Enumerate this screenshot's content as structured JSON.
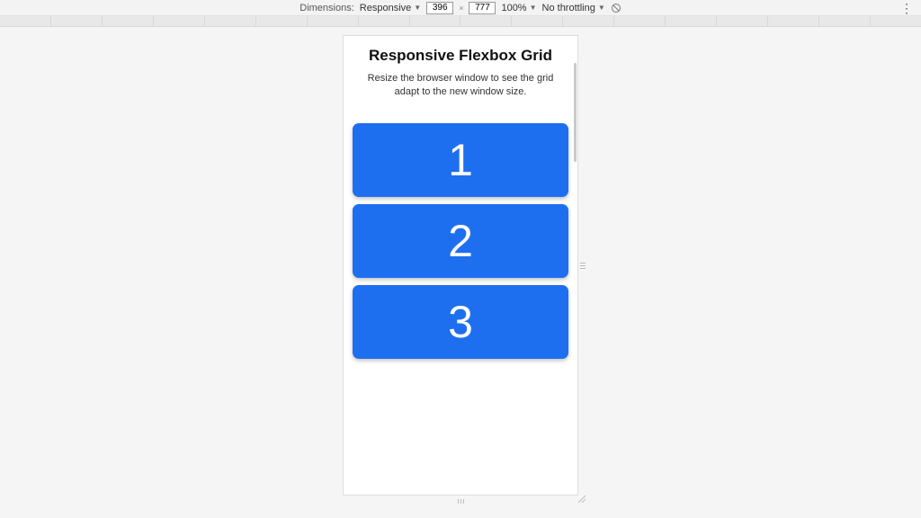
{
  "toolbar": {
    "dimensions_label": "Dimensions:",
    "device": "Responsive",
    "width": "396",
    "height": "777",
    "size_separator": "×",
    "zoom": "100%",
    "throttling": "No throttling"
  },
  "page": {
    "title": "Responsive Flexbox Grid",
    "subtitle": "Resize the browser window to see the grid adapt to the new window size.",
    "cards": [
      "1",
      "2",
      "3"
    ]
  },
  "colors": {
    "card_bg": "#1e6ff0"
  }
}
